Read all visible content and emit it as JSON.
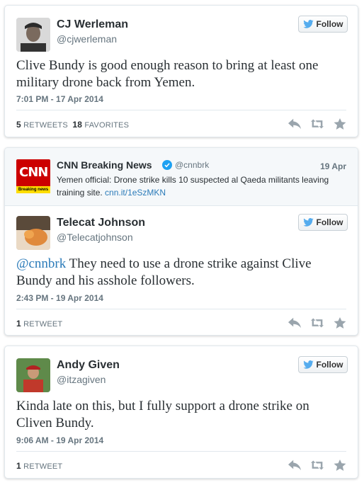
{
  "tweets": [
    {
      "name": "CJ Werleman",
      "handle": "@cjwerleman",
      "follow_label": "Follow",
      "text": "Clive Bundy is good enough reason to bring at least one military drone back from Yemen.",
      "time": "7:01 PM - 17 Apr 2014",
      "retweets_count": "5",
      "retweets_label": "RETWEETS",
      "favorites_count": "18",
      "favorites_label": "FAVORITES"
    },
    {
      "quoted": {
        "name": "CNN Breaking News",
        "handle": "@cnnbrk",
        "date": "19 Apr",
        "text": "Yemen official: Drone strike kills 10 suspected al Qaeda militants leaving training site.",
        "link": "cnn.it/1eSzMKN",
        "logo_text": "CNN",
        "logo_banner": "Breaking news"
      },
      "name": "Telecat Johnson",
      "handle": "@Telecatjohnson",
      "follow_label": "Follow",
      "mention": "@cnnbrk",
      "text": " They need to use a drone strike against Clive Bundy and his asshole followers.",
      "time": "2:43 PM - 19 Apr 2014",
      "retweets_count": "1",
      "retweets_label": "RETWEET"
    },
    {
      "name": "Andy Given",
      "handle": "@itzagiven",
      "follow_label": "Follow",
      "text": "Kinda late on this, but I fully support a drone strike on Cliven Bundy.",
      "time": "9:06 AM - 19 Apr 2014",
      "retweets_count": "1",
      "retweets_label": "RETWEET"
    }
  ],
  "colors": {
    "link": "#2b7bb9",
    "muted": "#66757f",
    "icon": "#9aa5ad",
    "cnn_red": "#cc0000",
    "verified": "#1da1f2"
  },
  "icons": [
    "twitter-bird-icon",
    "reply-icon",
    "retweet-icon",
    "favorite-icon",
    "verified-icon"
  ]
}
